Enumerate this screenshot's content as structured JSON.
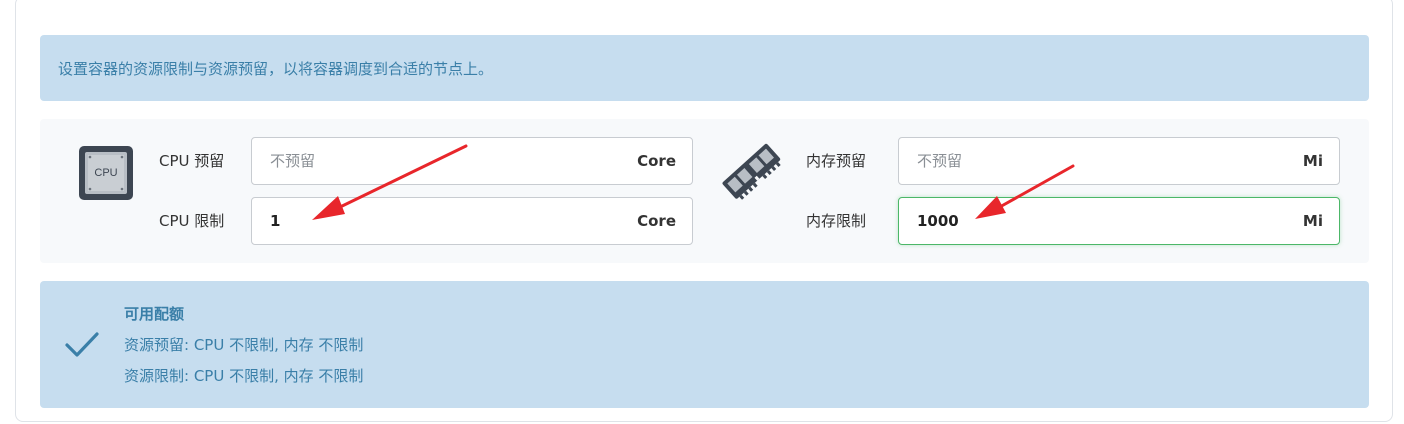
{
  "banner": {
    "text": "设置容器的资源限制与资源预留，以将容器调度到合适的节点上。"
  },
  "cpu": {
    "icon_name": "cpu-chip-icon",
    "icon_text": "CPU",
    "reservation": {
      "label": "CPU 预留",
      "value": "",
      "placeholder": "不预留",
      "unit": "Core"
    },
    "limit": {
      "label": "CPU 限制",
      "value": "1",
      "placeholder": "",
      "unit": "Core"
    }
  },
  "memory": {
    "icon_name": "memory-stick-icon",
    "reservation": {
      "label": "内存预留",
      "value": "",
      "placeholder": "不预留",
      "unit": "Mi"
    },
    "limit": {
      "label": "内存限制",
      "value": "1000",
      "placeholder": "",
      "unit": "Mi"
    }
  },
  "quota": {
    "title": "可用配额",
    "reservation_line": "资源预留:  CPU 不限制, 内存 不限制",
    "limit_line": "资源限制:  CPU 不限制, 内存 不限制"
  },
  "colors": {
    "banner_bg": "#c6ddef",
    "banner_text": "#3a7fa8",
    "focus_border": "#4cb768",
    "annotation_arrow": "#e8262b"
  }
}
